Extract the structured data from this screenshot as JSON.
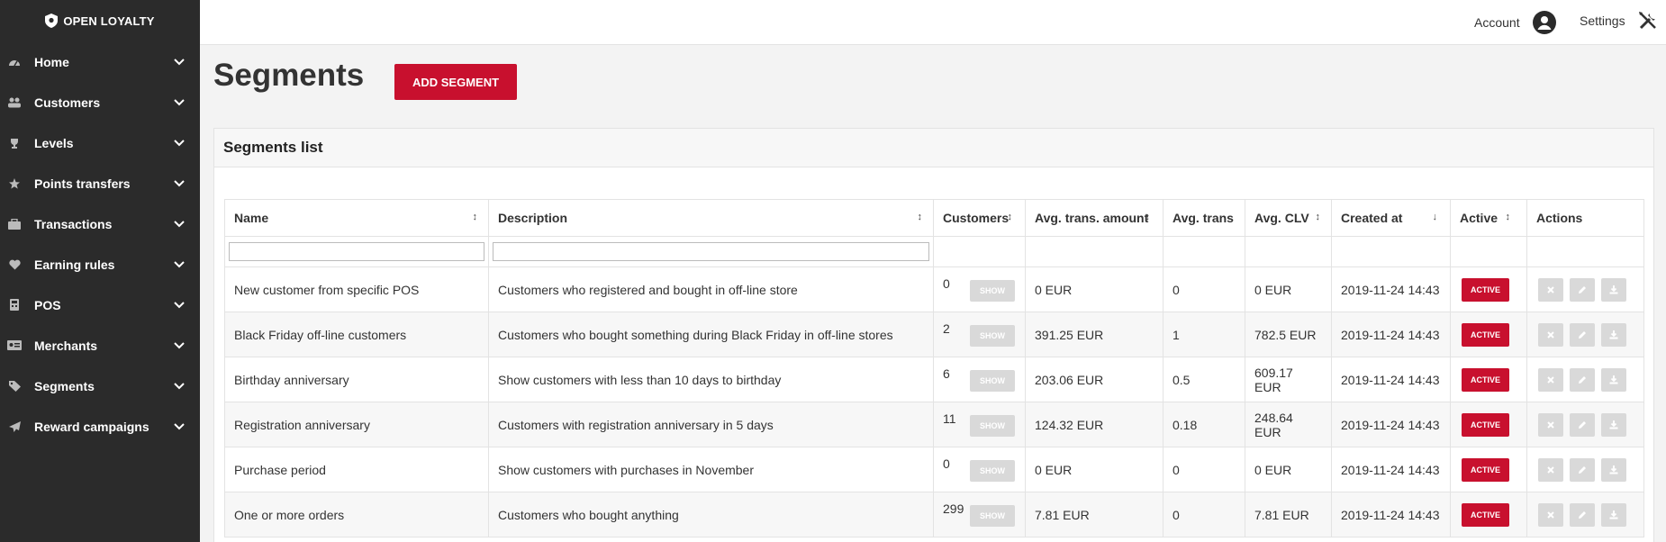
{
  "brand": {
    "name": "OPEN LOYALTY",
    "accent": "#c8102e",
    "sidebar_bg": "#2b2b2b"
  },
  "sidebar": {
    "items": [
      {
        "label": "Home",
        "icon": "dashboard-icon"
      },
      {
        "label": "Customers",
        "icon": "users-icon"
      },
      {
        "label": "Levels",
        "icon": "trophy-icon"
      },
      {
        "label": "Points transfers",
        "icon": "star-icon"
      },
      {
        "label": "Transactions",
        "icon": "briefcase-icon"
      },
      {
        "label": "Earning rules",
        "icon": "heart-icon"
      },
      {
        "label": "POS",
        "icon": "pos-icon"
      },
      {
        "label": "Merchants",
        "icon": "merchant-card-icon"
      },
      {
        "label": "Segments",
        "icon": "tag-icon"
      },
      {
        "label": "Reward campaigns",
        "icon": "paper-plane-icon"
      }
    ]
  },
  "topbar": {
    "account_label": "Account",
    "settings_label": "Settings"
  },
  "page": {
    "title": "Segments",
    "add_button": "ADD SEGMENT"
  },
  "panel": {
    "title": "Segments list"
  },
  "table": {
    "columns": [
      "Name",
      "Description",
      "Customers",
      "Avg. trans. amount",
      "Avg. trans",
      "Avg. CLV",
      "Created at",
      "Active",
      "Actions"
    ],
    "show_label": "SHOW",
    "active_label": "ACTIVE",
    "rows": [
      {
        "name": "New customer from specific POS",
        "description": "Customers who registered and bought in off-line store",
        "customers": "0",
        "avg_amount": "0 EUR",
        "avg_trans": "0",
        "avg_clv": "0 EUR",
        "created_at": "2019-11-24 14:43"
      },
      {
        "name": "Black Friday off-line customers",
        "description": "Customers who bought something during Black Friday in off-line stores",
        "customers": "2",
        "avg_amount": "391.25 EUR",
        "avg_trans": "1",
        "avg_clv": "782.5 EUR",
        "created_at": "2019-11-24 14:43"
      },
      {
        "name": "Birthday anniversary",
        "description": "Show customers with less than 10 days to birthday",
        "customers": "6",
        "avg_amount": "203.06 EUR",
        "avg_trans": "0.5",
        "avg_clv": "609.17 EUR",
        "created_at": "2019-11-24 14:43"
      },
      {
        "name": "Registration anniversary",
        "description": "Customers with registration anniversary in 5 days",
        "customers": "11",
        "avg_amount": "124.32 EUR",
        "avg_trans": "0.18",
        "avg_clv": "248.64 EUR",
        "created_at": "2019-11-24 14:43"
      },
      {
        "name": "Purchase period",
        "description": "Show customers with purchases in November",
        "customers": "0",
        "avg_amount": "0 EUR",
        "avg_trans": "0",
        "avg_clv": "0 EUR",
        "created_at": "2019-11-24 14:43"
      },
      {
        "name": "One or more orders",
        "description": "Customers who bought anything",
        "customers": "299",
        "avg_amount": "7.81 EUR",
        "avg_trans": "0",
        "avg_clv": "7.81 EUR",
        "created_at": "2019-11-24 14:43"
      }
    ]
  }
}
